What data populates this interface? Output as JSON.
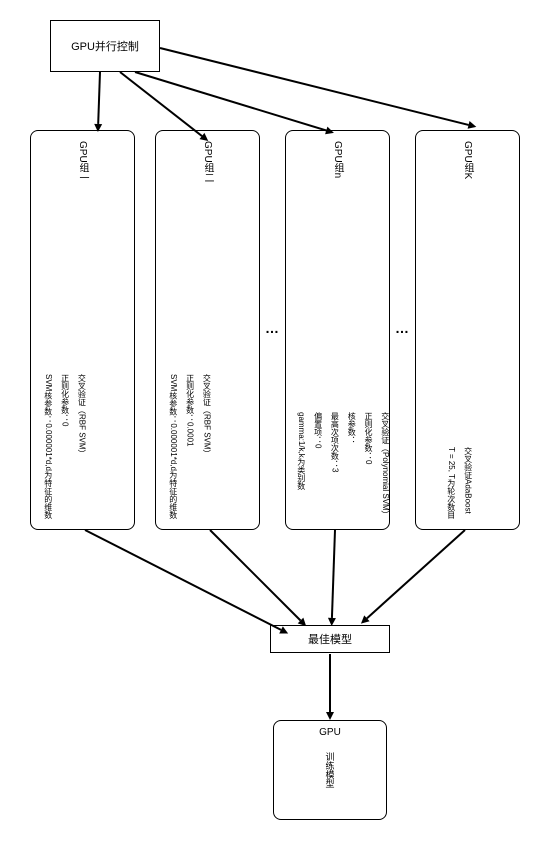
{
  "controller": {
    "title": "GPU并行控制"
  },
  "group1": {
    "title": "GPU组一",
    "line1": "交叉验证（RBF SVM）",
    "line2": "正则化参数：0",
    "line3": "SVM核参数：0.000001*d,d为特征的维数"
  },
  "group2": {
    "title": "GPU组二",
    "line1": "交叉验证（RBF SVM）",
    "line2": "正则化参数：0.0001",
    "line3": "SVM核参数：0.000001*d,d为特征的维数"
  },
  "groupN": {
    "title": "GPU组n",
    "line1": "交叉验证（Polynomial SVM）",
    "line2": "正则化参数：0",
    "line3": "核参数：",
    "line4": "最高次项次数：3",
    "line5": "偏置项：0",
    "line6": "gamma:1/k,k为类别数"
  },
  "groupK": {
    "title": "GPU组K",
    "line1": "交叉验证AdaBoost",
    "line2": "T = 25, T为轮次数目"
  },
  "best": {
    "label": "最佳模型"
  },
  "gpu": {
    "title": "GPU",
    "label": "训练模型"
  },
  "dots": "…"
}
